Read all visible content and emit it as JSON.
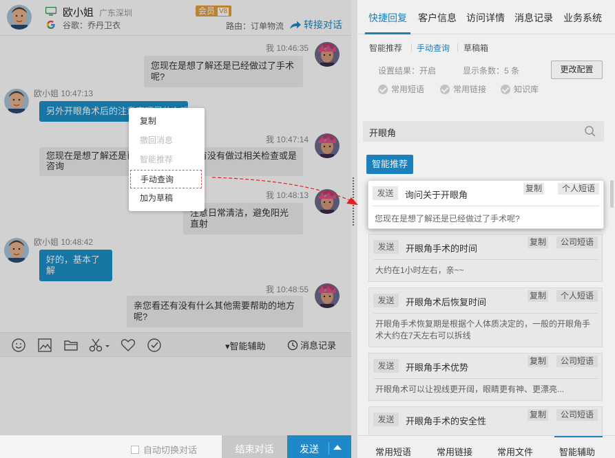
{
  "header": {
    "name": "欧小姐",
    "location": "广东深圳",
    "badge": "会员",
    "badge_sub": "V8",
    "keyword": "谷歌：乔丹卫衣",
    "route": "路由：订单物流",
    "transfer": "转接对话"
  },
  "messages": [
    {
      "dir": "out",
      "meta": "我 10:46:35",
      "text": "您现在是想了解还是已经做过了手术呢?"
    },
    {
      "dir": "in",
      "meta": "欧小姐 10:47:13",
      "text": "另外开眼角术后的注意事项是什么呢"
    },
    {
      "dir": "out",
      "meta": "我 10:47:14",
      "line1": "您现在是想了解还是已经做过了手术，有没有做过相关检查或是",
      "line2": "咨询"
    },
    {
      "dir": "out",
      "meta": "我 10:48:13",
      "text": "注意日常清洁，避免阳光直射"
    },
    {
      "dir": "in",
      "meta": "欧小姐 10:48:42",
      "text": "好的，基本了解"
    },
    {
      "dir": "out",
      "meta": "我 10:48:55",
      "text": "亲您看还有没有什么其他需要帮助的地方呢?"
    }
  ],
  "context_menu": {
    "copy": "复制",
    "recall": "撤回消息",
    "smart": "智能推荐",
    "manual": "手动查询",
    "draft": "加为草稿"
  },
  "toolbar": {
    "assist": "▾智能辅助",
    "history": "消息记录"
  },
  "bottom": {
    "auto_switch": "自动切换对话",
    "end": "结束对话",
    "send": "发送"
  },
  "right_tabs": [
    "快捷回复",
    "客户信息",
    "访问详情",
    "消息记录",
    "业务系统"
  ],
  "sub_tabs": [
    "智能推荐",
    "手动查询",
    "草稿箱"
  ],
  "settings": {
    "result": "设置结果：开启",
    "count": "显示条数：5 条",
    "change": "更改配置",
    "checks": [
      "常用短语",
      "常用链接",
      "知识库"
    ]
  },
  "search": {
    "value": "开眼角"
  },
  "smart_button": "智能推荐",
  "cards": [
    {
      "send": "发送",
      "title": "询问关于开眼角",
      "copy": "复制",
      "type": "个人短语",
      "body": "您现在是想了解还是已经做过了手术呢?"
    },
    {
      "send": "发送",
      "title": "开眼角手术的时间",
      "copy": "复制",
      "type": "公司短语",
      "body": "大约在1小时左右，亲~~"
    },
    {
      "send": "发送",
      "title": "开眼角术后恢复时间",
      "copy": "复制",
      "type": "个人短语",
      "body": "开眼角手术恢复期是根据个人体质决定的，一般的开眼角手术大约在7天左右可以拆线"
    },
    {
      "send": "发送",
      "title": "开眼角手术优势",
      "copy": "复制",
      "type": "公司短语",
      "body": "开眼角术可以让视线更开阔，眼睛更有神、更漂亮..."
    },
    {
      "send": "发送",
      "title": "开眼角手术的安全性",
      "copy": "复制",
      "type": "公司短语",
      "body": ""
    }
  ],
  "bottom_tabs": [
    "常用短语",
    "常用链接",
    "常用文件",
    "智能辅助"
  ],
  "colors": {
    "accent": "#1e88c8",
    "badge": "#e6a23c",
    "annotation": "#e02020"
  },
  "icons": [
    "monitor-icon",
    "google-icon",
    "transfer-arrow-icon",
    "emoji-icon",
    "image-icon",
    "folder-icon",
    "scissors-icon",
    "heart-icon",
    "rating-icon",
    "clock-icon",
    "search-icon",
    "check-icon"
  ]
}
